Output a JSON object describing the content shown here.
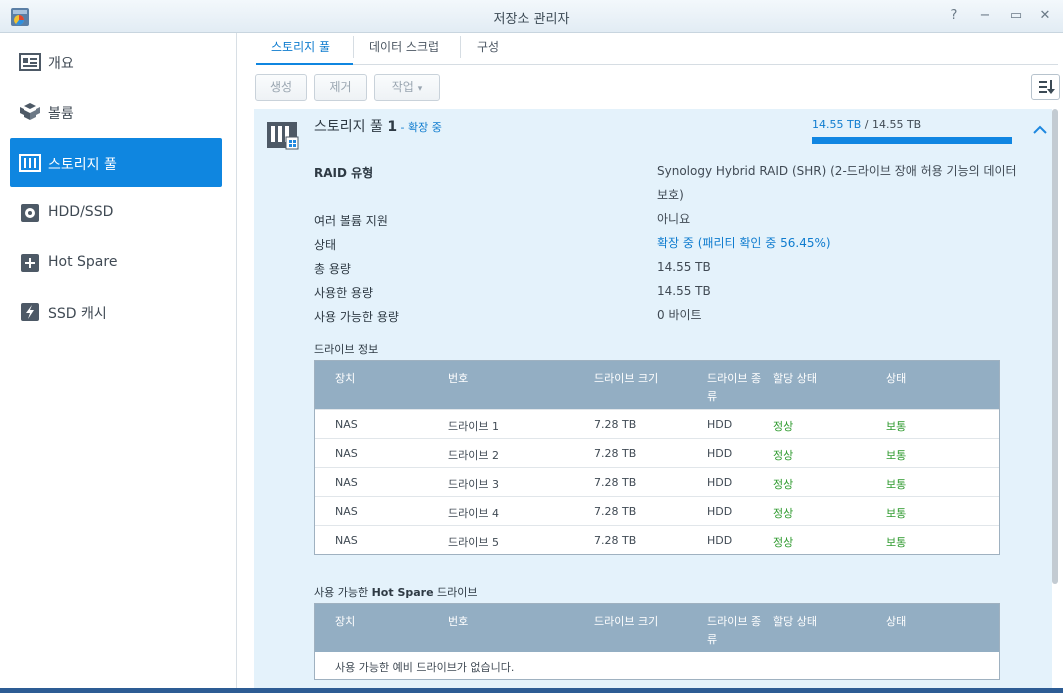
{
  "window": {
    "title": "저장소 관리자",
    "help_glyph": "?",
    "min_glyph": "−",
    "max_glyph": "▭",
    "close_glyph": "✕"
  },
  "sidebar": {
    "items": [
      {
        "label": "개요",
        "icon": "overview-icon",
        "active": false
      },
      {
        "label": "볼륨",
        "icon": "volume-icon",
        "active": false
      },
      {
        "label": "스토리지 풀",
        "icon": "storage-pool-icon",
        "active": true
      },
      {
        "label": "HDD/SSD",
        "icon": "hdd-icon",
        "active": false
      },
      {
        "label": "Hot Spare",
        "icon": "hot-spare-icon",
        "active": false
      },
      {
        "label": "SSD 캐시",
        "icon": "ssd-cache-icon",
        "active": false
      }
    ]
  },
  "tabs": [
    {
      "label": "스토리지 풀",
      "active": true
    },
    {
      "label": "데이터 스크럽",
      "active": false
    },
    {
      "label": "구성",
      "active": false
    }
  ],
  "toolbar": {
    "create": "생성",
    "remove": "제거",
    "action": "작업",
    "action_caret": "▾"
  },
  "pool": {
    "name_prefix": "스토리지 풀 ",
    "name_number": "1",
    "status_suffix": " - 확장 중",
    "capacity_used": "14.55 TB",
    "capacity_sep": " / ",
    "capacity_total": "14.55 TB",
    "capacity_fraction": 1.0,
    "properties": {
      "raid_label": "RAID 유형",
      "raid_value": "Synology Hybrid RAID (SHR) (2-드라이브 장애 허용 기능의 데이터 보호)",
      "multi_label": "여러 볼륨 지원",
      "multi_value": "아니요",
      "status_label": "상태",
      "status_value": "확장 중 (패리티 확인 중 56.45%)",
      "total_label": "총 용량",
      "total_value": "14.55 TB",
      "used_label": "사용한 용량",
      "used_value": "14.55 TB",
      "avail_label": "사용 가능한 용량",
      "avail_value": "0 바이트"
    }
  },
  "drive_info": {
    "title": "드라이브 정보",
    "columns": [
      "장치",
      "번호",
      "드라이브 크기",
      "드라이브 종류",
      "할당 상태",
      "상태"
    ],
    "col_type_line1": "드라이브 종",
    "col_type_line2": "류",
    "rows": [
      {
        "device": "NAS",
        "number": "드라이브 1",
        "size": "7.28 TB",
        "type": "HDD",
        "alloc": "정상",
        "status": "보통"
      },
      {
        "device": "NAS",
        "number": "드라이브 2",
        "size": "7.28 TB",
        "type": "HDD",
        "alloc": "정상",
        "status": "보통"
      },
      {
        "device": "NAS",
        "number": "드라이브 3",
        "size": "7.28 TB",
        "type": "HDD",
        "alloc": "정상",
        "status": "보통"
      },
      {
        "device": "NAS",
        "number": "드라이브 4",
        "size": "7.28 TB",
        "type": "HDD",
        "alloc": "정상",
        "status": "보통"
      },
      {
        "device": "NAS",
        "number": "드라이브 5",
        "size": "7.28 TB",
        "type": "HDD",
        "alloc": "정상",
        "status": "보통"
      }
    ]
  },
  "hot_spare": {
    "title_prefix": "사용 가능한 ",
    "title_bold": "Hot Spare",
    "title_suffix": " 드라이브",
    "empty_message": "사용 가능한 예비 드라이브가 없습니다."
  },
  "colors": {
    "accent": "#0f86e0",
    "ok_green": "#2e9a2e",
    "panel": "#e4f2fb",
    "table_header": "#93aec3"
  }
}
